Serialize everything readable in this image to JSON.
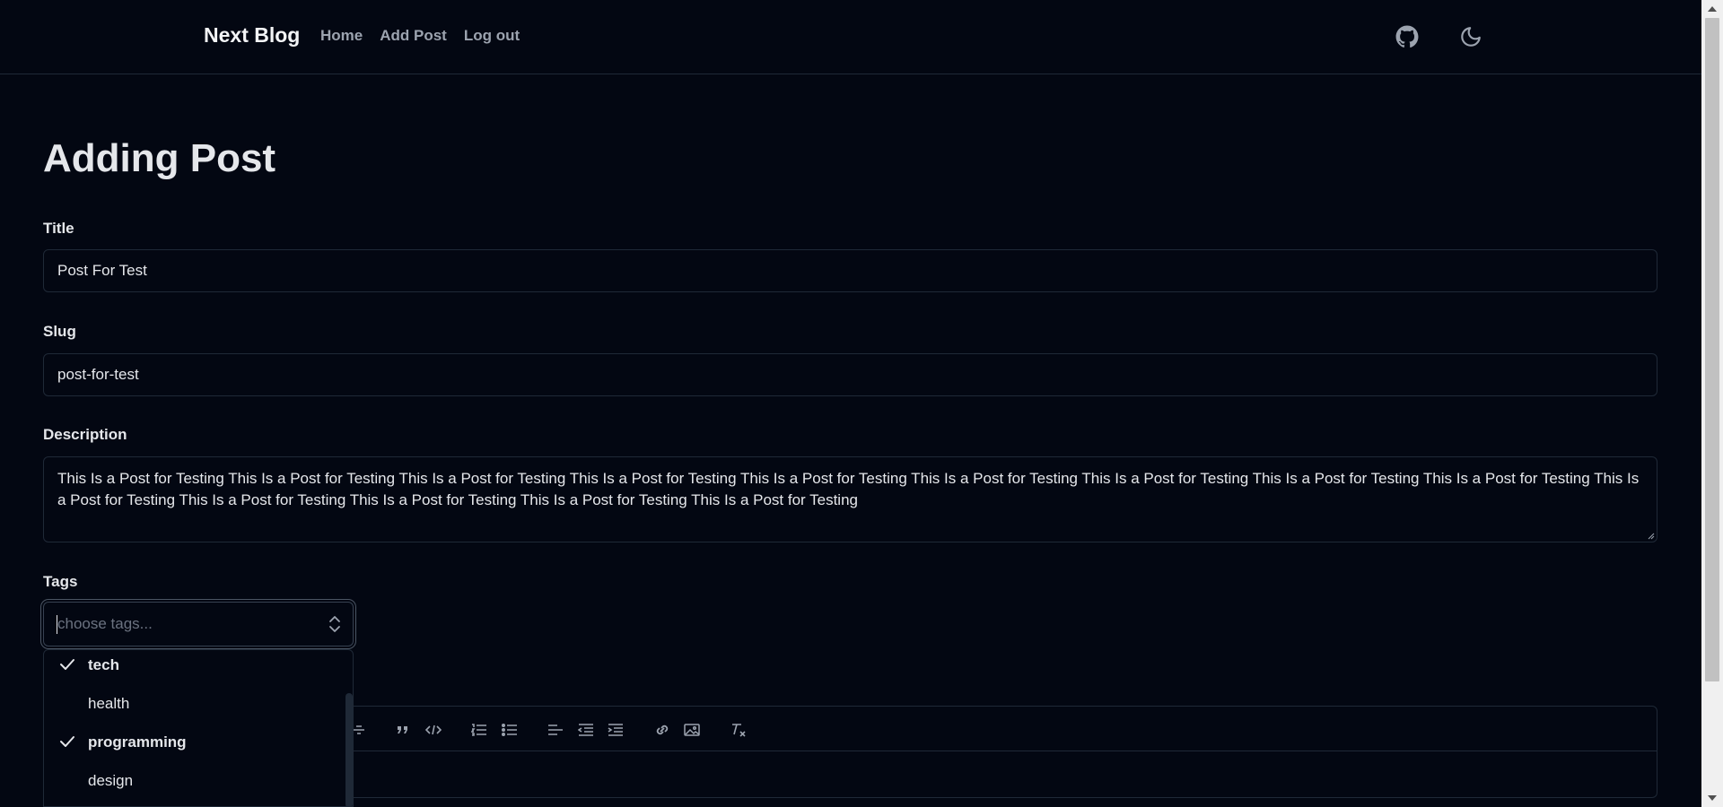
{
  "header": {
    "brand": "Next Blog",
    "nav": [
      "Home",
      "Add Post",
      "Log out"
    ],
    "icons": [
      "github-icon",
      "moon-icon"
    ]
  },
  "page": {
    "title": "Adding Post"
  },
  "form": {
    "title_label": "Title",
    "title_value": "Post For Test",
    "slug_label": "Slug",
    "slug_value": "post-for-test",
    "description_label": "Description",
    "description_value": "This Is a Post for Testing This Is a Post for Testing This Is a Post for Testing This Is a Post for Testing This Is a Post for Testing This Is a Post for Testing This Is a Post for Testing This Is a Post for Testing This Is a Post for Testing This Is a Post for Testing This Is a Post for Testing This Is a Post for Testing This Is a Post for Testing This Is a Post for Testing",
    "tags_label": "Tags",
    "tags_placeholder": "choose tags..."
  },
  "tags_dropdown": {
    "options": [
      {
        "label": "tech",
        "selected": true
      },
      {
        "label": "health",
        "selected": false
      },
      {
        "label": "programming",
        "selected": true
      },
      {
        "label": "design",
        "selected": false
      }
    ]
  },
  "editor": {
    "toolbar_icons": [
      "strikethrough-icon",
      "quote-icon",
      "code-icon",
      "ordered-list-icon",
      "bullet-list-icon",
      "align-left-icon",
      "outdent-icon",
      "indent-icon",
      "link-icon",
      "image-icon",
      "clear-format-icon"
    ]
  },
  "colors": {
    "background": "#030712",
    "border": "#1f2937",
    "text": "#e5e7eb",
    "muted": "#9ca3af"
  }
}
